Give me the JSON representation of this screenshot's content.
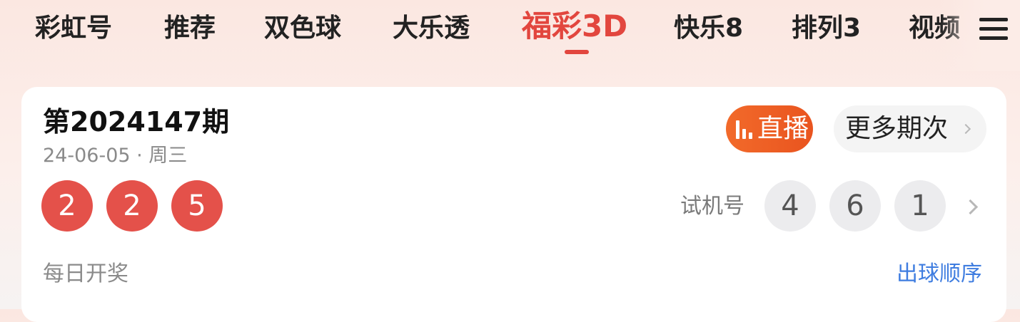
{
  "tabs": [
    {
      "label": "彩虹号",
      "active": false
    },
    {
      "label": "推荐",
      "active": false
    },
    {
      "label": "双色球",
      "active": false
    },
    {
      "label": "大乐透",
      "active": false
    },
    {
      "label": "福彩3D",
      "active": true
    },
    {
      "label": "快乐8",
      "active": false
    },
    {
      "label": "排列3",
      "active": false
    },
    {
      "label": "视频",
      "active": false
    }
  ],
  "menu_icon": "menu-icon",
  "card": {
    "issue_title": "第2024147期",
    "date": "24-06-05 · 周三",
    "winning_numbers": [
      "2",
      "2",
      "5"
    ],
    "live_button": {
      "icon": "bar-chart-icon",
      "label": "直播"
    },
    "more_button": {
      "label": "更多期次"
    },
    "test_label": "试机号",
    "test_numbers": [
      "4",
      "6",
      "1"
    ],
    "footer_left": "每日开奖",
    "footer_right": "出球顺序"
  },
  "colors": {
    "accent_red": "#e2463e",
    "ball_red": "#e4514a",
    "live_orange": "#f26a2a",
    "link_blue": "#3f7de0"
  }
}
